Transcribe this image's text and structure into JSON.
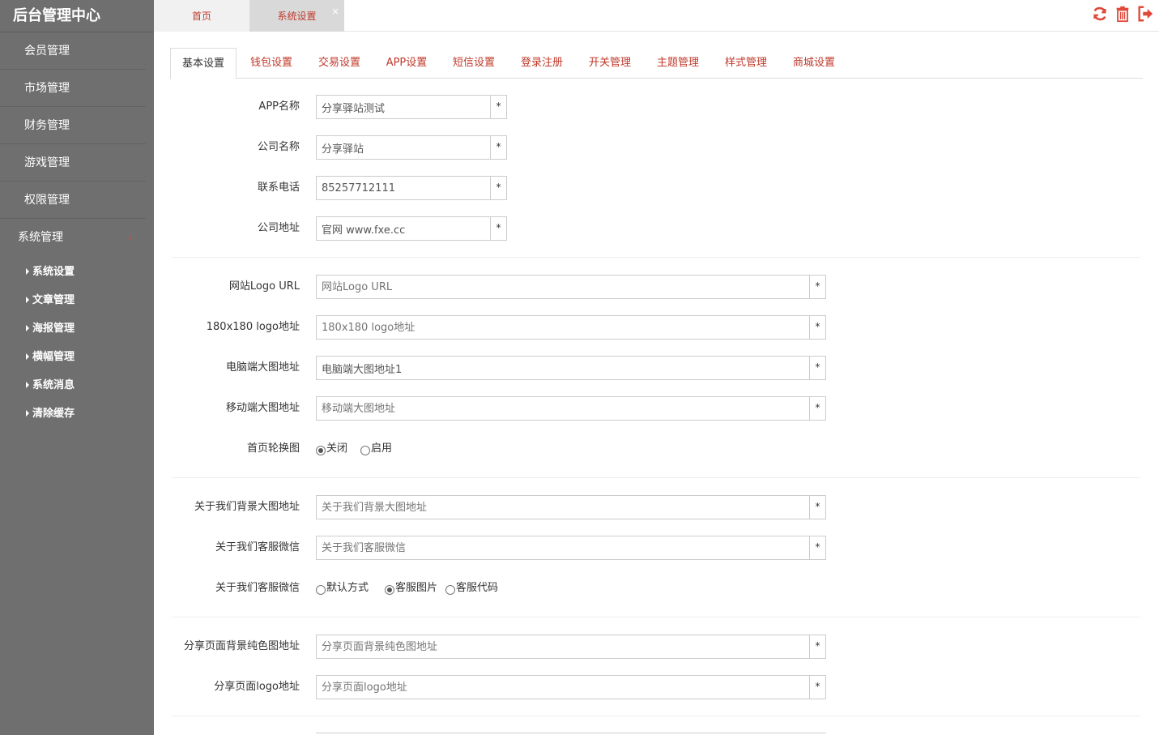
{
  "sidebar": {
    "brand": "后台管理中心",
    "menu": [
      {
        "label": "会员管理"
      },
      {
        "label": "市场管理"
      },
      {
        "label": "财务管理"
      },
      {
        "label": "游戏管理"
      },
      {
        "label": "权限管理"
      }
    ],
    "expanded": {
      "label": "系统管理",
      "chevron": "›"
    },
    "submenu": [
      {
        "label": "系统设置"
      },
      {
        "label": "文章管理"
      },
      {
        "label": "海报管理"
      },
      {
        "label": "横幅管理"
      },
      {
        "label": "系统消息"
      },
      {
        "label": "清除缓存"
      }
    ]
  },
  "topbar": {
    "tabs": [
      {
        "label": "首页"
      },
      {
        "label": "系统设置",
        "close": "×"
      }
    ],
    "icons": [
      "refresh-icon",
      "trash-icon",
      "logout-icon"
    ],
    "icon_color": "#e0483a"
  },
  "settings_tabs": [
    "基本设置",
    "钱包设置",
    "交易设置",
    "APP设置",
    "短信设置",
    "登录注册",
    "开关管理",
    "主题管理",
    "样式管理",
    "商城设置"
  ],
  "form": {
    "required_mark": "*",
    "app_name": {
      "label": "APP名称",
      "value": "分享驿站测试"
    },
    "company_name": {
      "label": "公司名称",
      "value": "分享驿站"
    },
    "phone": {
      "label": "联系电话",
      "value": "85257712111"
    },
    "address": {
      "label": "公司地址",
      "value": "官网 www.fxe.cc"
    },
    "logo_url": {
      "label": "网站Logo URL",
      "placeholder": "网站Logo URL"
    },
    "logo_180": {
      "label": "180x180 logo地址",
      "placeholder": "180x180 logo地址"
    },
    "pc_banner": {
      "label": "电脑端大图地址",
      "value": "电脑端大图地址1"
    },
    "mobile_banner": {
      "label": "移动端大图地址",
      "placeholder": "移动端大图地址"
    },
    "carousel": {
      "label": "首页轮换图",
      "options": [
        "关闭",
        "启用"
      ],
      "selected": "关闭"
    },
    "about_bg": {
      "label": "关于我们背景大图地址",
      "placeholder": "关于我们背景大图地址"
    },
    "about_wechat": {
      "label": "关于我们客服微信",
      "placeholder": "关于我们客服微信"
    },
    "about_wechat_mode": {
      "label": "关于我们客服微信",
      "options": [
        "默认方式",
        "客服图片",
        "客服代码"
      ],
      "selected": "客服图片"
    },
    "share_bg": {
      "label": "分享页面背景纯色图地址",
      "placeholder": "分享页面背景纯色图地址"
    },
    "share_logo": {
      "label": "分享页面logo地址",
      "placeholder": "分享页面logo地址"
    }
  }
}
